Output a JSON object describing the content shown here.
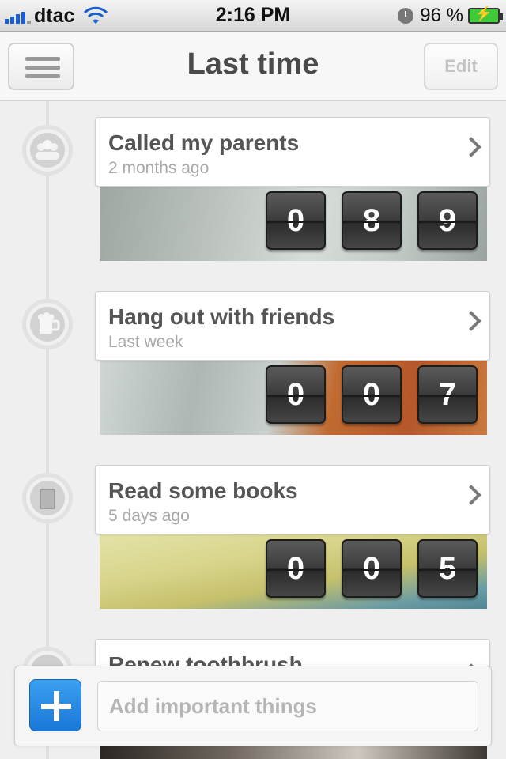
{
  "status_bar": {
    "carrier": "dtac",
    "time": "2:16 PM",
    "battery": "96 %"
  },
  "nav": {
    "title": "Last time",
    "edit_label": "Edit"
  },
  "items": [
    {
      "title": "Called my parents",
      "subtitle": "2 months ago",
      "digits": [
        "0",
        "8",
        "9"
      ],
      "icon": "people-icon"
    },
    {
      "title": "Hang out with friends",
      "subtitle": "Last week",
      "digits": [
        "0",
        "0",
        "7"
      ],
      "icon": "beer-mug-icon"
    },
    {
      "title": "Read some books",
      "subtitle": "5 days ago",
      "digits": [
        "0",
        "0",
        "5"
      ],
      "icon": "book-icon"
    },
    {
      "title": "Renew toothbrush",
      "icon": "toothbrush-icon"
    }
  ],
  "add_bar": {
    "placeholder": "Add important things"
  },
  "colors": {
    "accent": "#1a78d8",
    "title_text": "#4a4a4a",
    "subtitle_text": "#a8a8a8"
  }
}
